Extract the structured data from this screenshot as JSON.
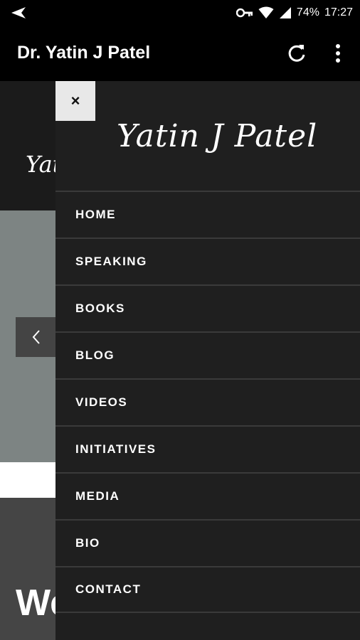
{
  "status_bar": {
    "battery": "74%",
    "time": "17:27",
    "icons": [
      "key-icon",
      "wifi-icon",
      "signal-icon"
    ]
  },
  "app_bar": {
    "title": "Dr. Yatin J Patel",
    "actions": [
      "refresh-icon",
      "more-vert-icon"
    ]
  },
  "background_page": {
    "logo_peek": "Yati",
    "heading_peek": "We"
  },
  "drawer": {
    "close_symbol": "×",
    "logo_text": "Yatin J Patel",
    "nav_items": [
      {
        "label": "HOME"
      },
      {
        "label": "SPEAKING"
      },
      {
        "label": "BOOKS"
      },
      {
        "label": "BLOG"
      },
      {
        "label": "VIDEOS"
      },
      {
        "label": "INITIATIVES"
      },
      {
        "label": "MEDIA"
      },
      {
        "label": "BIO"
      },
      {
        "label": "CONTACT"
      }
    ]
  },
  "colors": {
    "drawer_bg": "#1f1f1f",
    "divider": "#3a3a3a",
    "slider_bg": "#7d8483",
    "close_bg": "#e8e8e8"
  }
}
